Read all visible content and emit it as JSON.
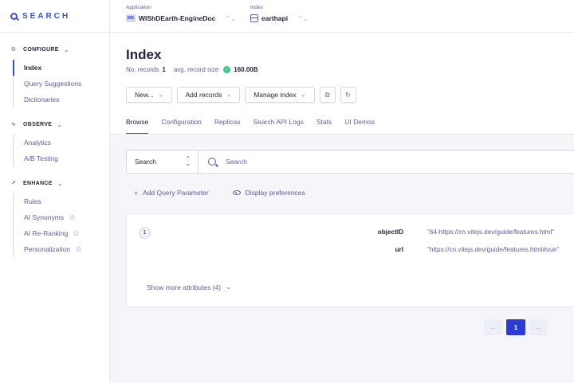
{
  "brand": {
    "name": "SEARCH"
  },
  "sidebar": {
    "sections": [
      {
        "title": "CONFIGURE",
        "items": [
          "Index",
          "Query Suggestions",
          "Dictionaries"
        ]
      },
      {
        "title": "OBSERVE",
        "items": [
          "Analytics",
          "A/B Testing"
        ]
      },
      {
        "title": "ENHANCE",
        "items": [
          "Rules",
          "AI Synonyms",
          "AI Re-Ranking",
          "Personalization"
        ]
      }
    ],
    "active_item": "Index"
  },
  "topbar": {
    "application": {
      "label": "Application",
      "badge": "WE",
      "value": "WIShDEarth-EngineDoc"
    },
    "index": {
      "label": "Index",
      "value": "earthapi"
    }
  },
  "page": {
    "title": "Index",
    "records_label": "No. records",
    "records_value": "1",
    "size_label": "avg. record size",
    "size_value": "160.00B"
  },
  "toolbar": {
    "new_label": "New...",
    "add_records_label": "Add records",
    "manage_index_label": "Manage index"
  },
  "tabs": [
    "Browse",
    "Configuration",
    "Replicas",
    "Search API Logs",
    "Stats",
    "UI Demos"
  ],
  "search": {
    "mode": "Search",
    "placeholder": "Search"
  },
  "actions": {
    "add_param": "Add Query Parameter",
    "display_prefs": "Display preferences"
  },
  "record": {
    "number": "1",
    "attributes": [
      {
        "key": "objectID",
        "value": "\"64-https://cn.vitejs.dev/guide/features.html\""
      },
      {
        "key": "url",
        "value": "\"https://cn.vitejs.dev/guide/features.html#vue\""
      }
    ],
    "show_more": "Show more attributes (4)"
  },
  "pagination": {
    "prev": "←",
    "current": "1",
    "next": "→"
  },
  "colors": {
    "accent": "#3a4fd6",
    "success": "#3ec48a",
    "page_active": "#2b3bd1"
  }
}
